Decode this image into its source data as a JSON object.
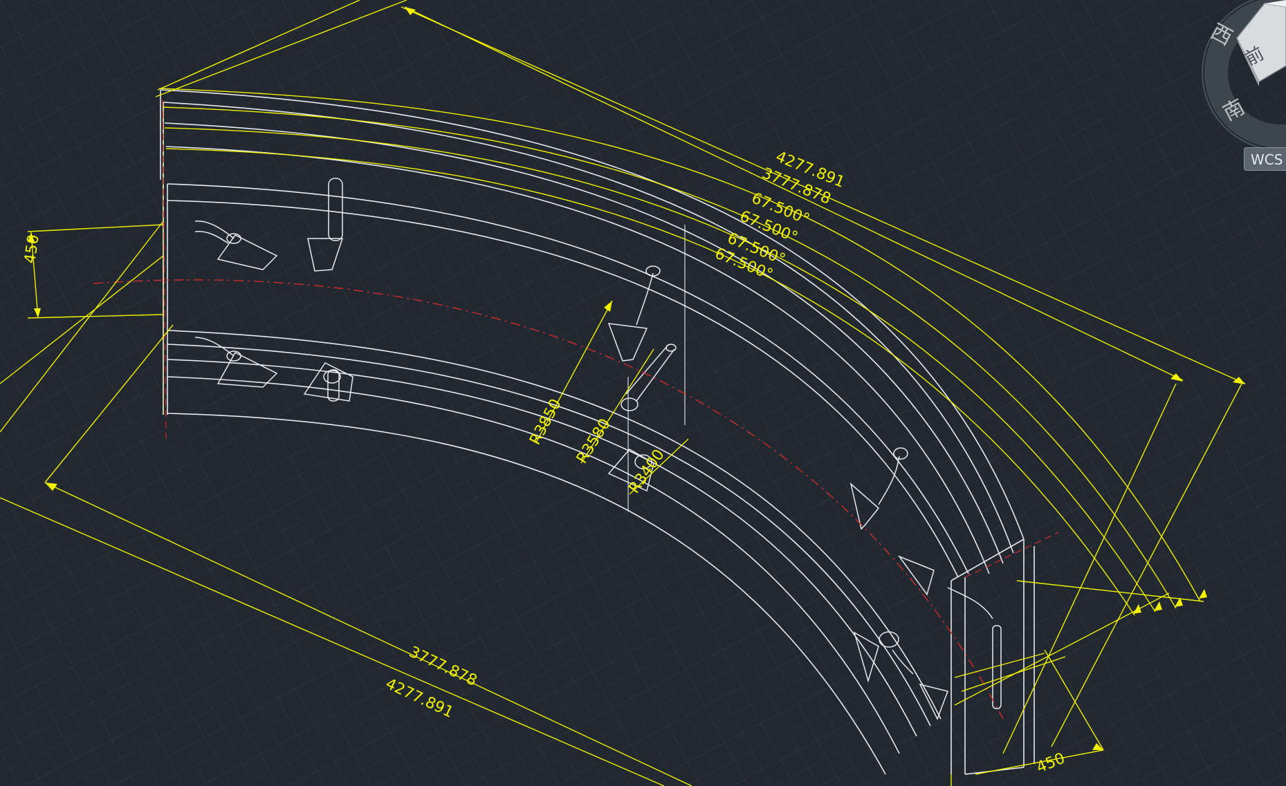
{
  "viewcube": {
    "west_label": "西",
    "front_label": "前",
    "south_label": "南",
    "wcs_label": "WCS"
  },
  "dimensions": {
    "outer_arc_length": "4277.891",
    "inner_arc_length": "3777.878",
    "angle_1": "67.500°",
    "angle_2": "67.500°",
    "angle_3": "67.500°",
    "angle_4": "67.500°",
    "bottom_inner_length": "3777.878",
    "bottom_outer_length": "4277.891",
    "left_height": "450",
    "bottom_right_width": "450",
    "radius_1": "R3850",
    "radius_2": "R3580",
    "radius_3": "R3400"
  },
  "colors": {
    "background": "#212830",
    "grid": "#2f3843",
    "dimension": "#f2f200",
    "geometry": "#e8ecf0",
    "centerline": "#d42a2a"
  }
}
